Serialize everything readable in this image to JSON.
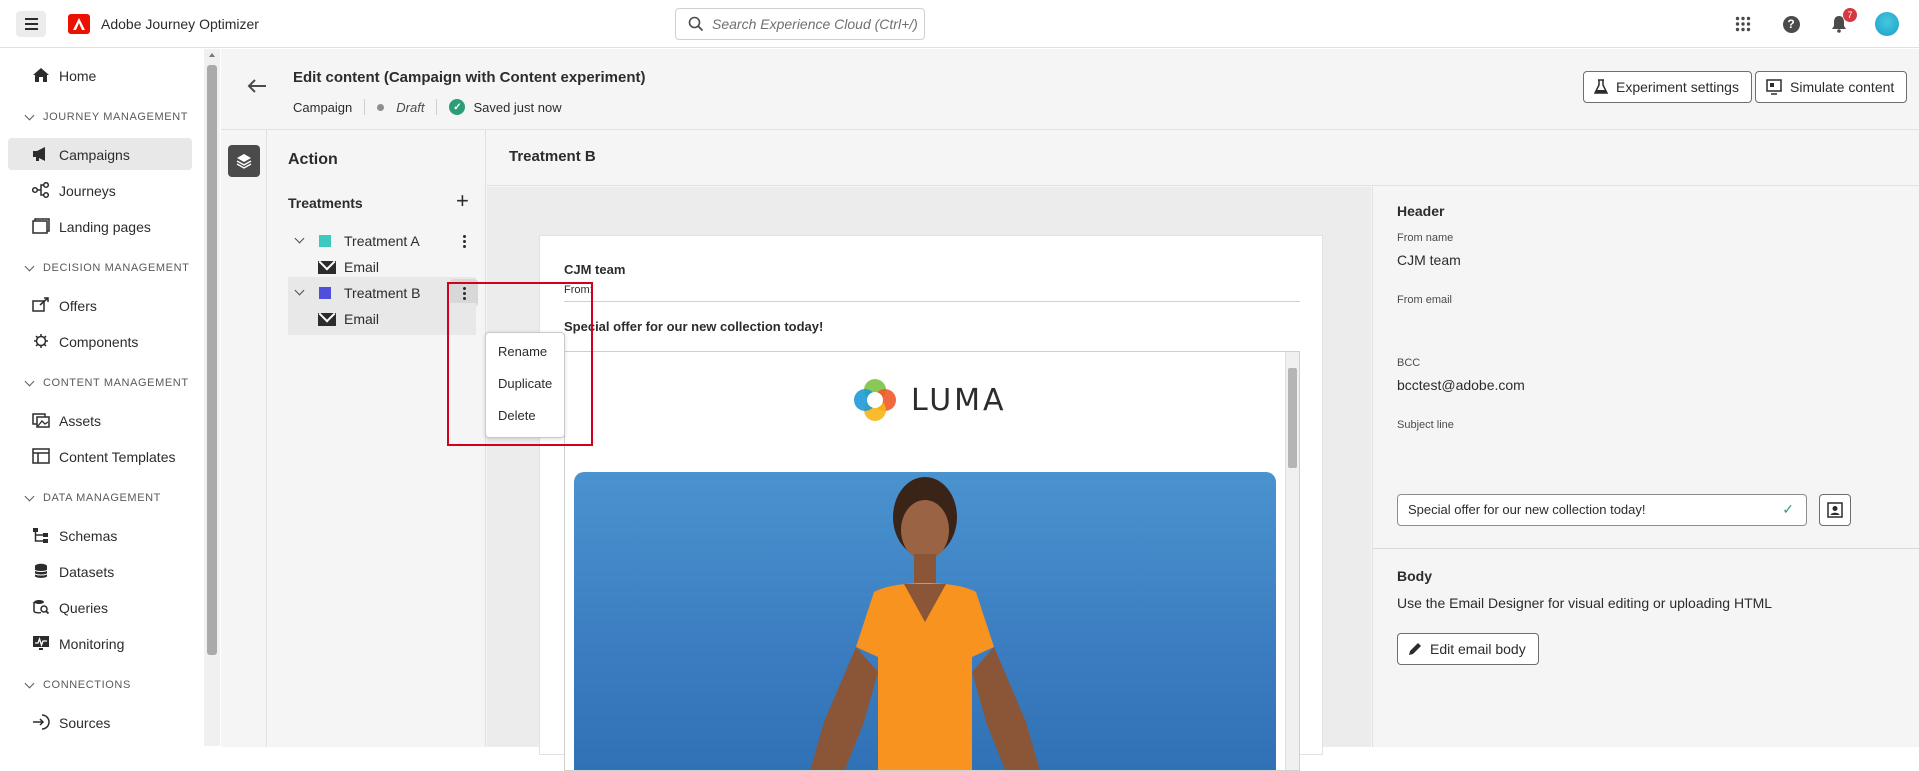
{
  "app": {
    "title": "Adobe Journey Optimizer",
    "search_placeholder": "Search Experience Cloud (Ctrl+/)",
    "notification_count": "7",
    "brand_color": "#eb1000"
  },
  "sidebar": {
    "home": "Home",
    "sections": {
      "journey": "JOURNEY MANAGEMENT",
      "decision": "DECISION MANAGEMENT",
      "content": "CONTENT MANAGEMENT",
      "data": "DATA MANAGEMENT",
      "connections": "CONNECTIONS"
    },
    "items": {
      "campaigns": "Campaigns",
      "journeys": "Journeys",
      "landing_pages": "Landing pages",
      "offers": "Offers",
      "components": "Components",
      "assets": "Assets",
      "content_templates": "Content Templates",
      "schemas": "Schemas",
      "datasets": "Datasets",
      "queries": "Queries",
      "monitoring": "Monitoring",
      "sources": "Sources"
    }
  },
  "header": {
    "title": "Edit content (Campaign with Content experiment)",
    "type": "Campaign",
    "status": "Draft",
    "saved": "Saved just now",
    "experiment_settings": "Experiment settings",
    "simulate_content": "Simulate content"
  },
  "action": {
    "title": "Action",
    "treatments_label": "Treatments",
    "treatments": [
      {
        "name": "Treatment A",
        "channel": "Email",
        "color": "#3ec9c0"
      },
      {
        "name": "Treatment B",
        "channel": "Email",
        "color": "#4f4fd9"
      }
    ],
    "menu": [
      "Rename",
      "Duplicate",
      "Delete"
    ]
  },
  "editor": {
    "title": "Treatment B",
    "preview": {
      "from_name": "CJM team",
      "from_label": "From:",
      "subject": "Special offer for our new collection today!",
      "logo_text": "LUMA"
    }
  },
  "properties": {
    "header_label": "Header",
    "from_name_label": "From name",
    "from_name": "CJM team",
    "from_email_label": "From email",
    "bcc_label": "BCC",
    "bcc": "bcctest@adobe.com",
    "subject_label": "Subject line",
    "subject": "Special offer for our new collection today!",
    "body_label": "Body",
    "body_hint": "Use the Email Designer for visual editing or uploading HTML",
    "edit_body": "Edit email body"
  }
}
